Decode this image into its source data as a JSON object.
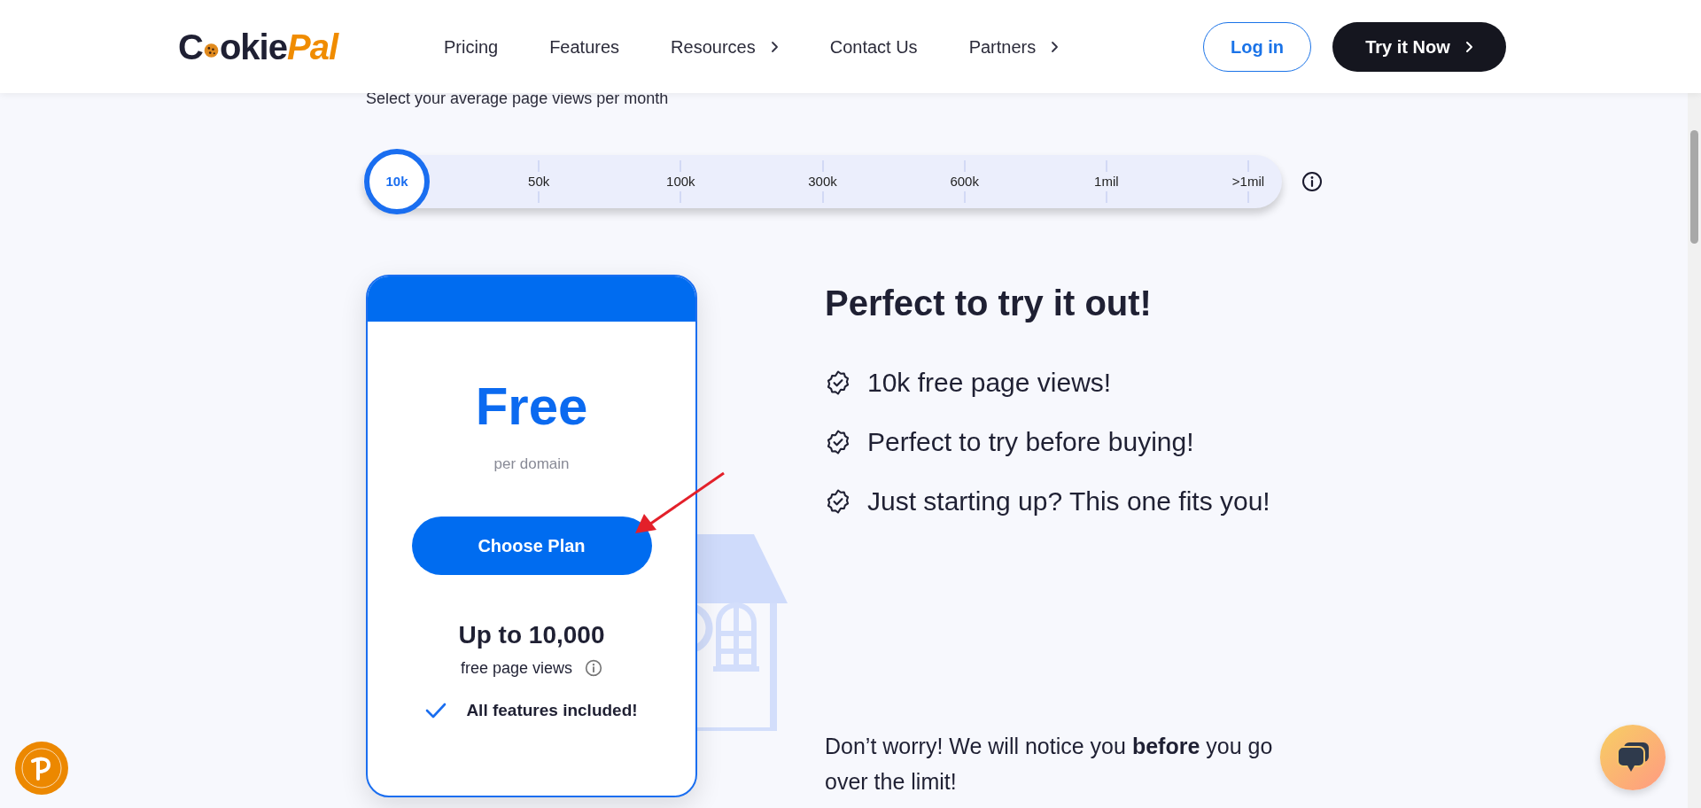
{
  "header": {
    "logo": {
      "first": "C",
      "rest": "okie",
      "accent": "Pal"
    },
    "nav": [
      {
        "label": "Pricing",
        "has_submenu": false
      },
      {
        "label": "Features",
        "has_submenu": false
      },
      {
        "label": "Resources",
        "has_submenu": true
      },
      {
        "label": "Contact Us",
        "has_submenu": false
      },
      {
        "label": "Partners",
        "has_submenu": true
      }
    ],
    "login": "Log in",
    "cta": "Try it Now"
  },
  "slider": {
    "title": "Select your average page views per month",
    "level": 0,
    "stops": [
      {
        "label": "10k",
        "selected": true
      },
      {
        "label": "50k",
        "selected": false
      },
      {
        "label": "100k",
        "selected": false
      },
      {
        "label": "300k",
        "selected": false
      },
      {
        "label": "600k",
        "selected": false
      },
      {
        "label": "1mil",
        "selected": false
      },
      {
        "label": ">1mil",
        "selected": false
      }
    ]
  },
  "plan": {
    "price": "Free",
    "unit": "per domain",
    "button": "Choose Plan",
    "limit": "Up to 10,000",
    "limit_note": "free page views",
    "feature": "All features included!"
  },
  "details": {
    "heading": "Perfect to try it out!",
    "bullets": [
      "10k free page views!",
      "Perfect to try before buying!",
      "Just starting up? This one fits you!"
    ],
    "note": "Don’t worry! We will notice you **before** you go over the limit!"
  }
}
